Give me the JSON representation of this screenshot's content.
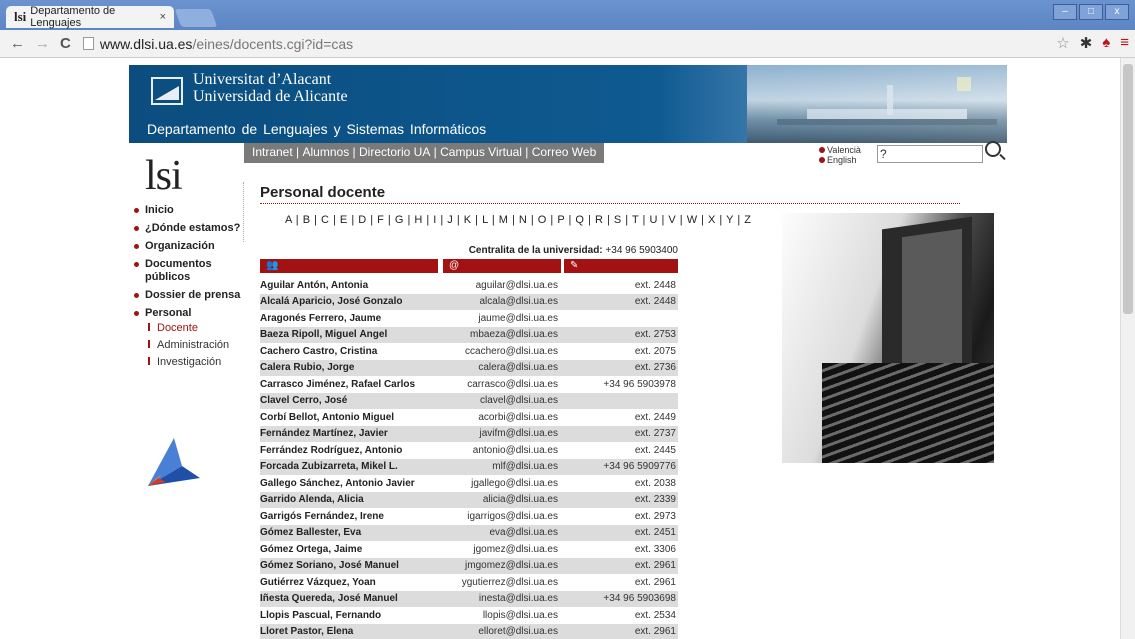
{
  "browser": {
    "tab_title": "Departamento de Lenguajes",
    "tab_favicon": "lsi",
    "url_host": "www.dlsi.ua.es",
    "url_path": "/eines/docents.cgi?id=cas",
    "icons": [
      "back-icon",
      "forward-icon",
      "reload-icon",
      "star-icon",
      "settings-icon",
      "extension-icon",
      "menu-icon"
    ]
  },
  "header": {
    "university_line1": "Universitat d’Alacant",
    "university_line2": "Universidad de Alicante",
    "department": "Departamento de Lenguajes y Sistemas Informáticos",
    "logo": "lsi"
  },
  "topnav": [
    "Intranet",
    "Alumnos",
    "Directorio UA",
    "Campus Virtual",
    "Correo Web"
  ],
  "lang": {
    "valencia": "Valencià",
    "english": "English"
  },
  "search": {
    "value": "?"
  },
  "leftnav": {
    "items": [
      "Inicio",
      "¿Dónde estamos?",
      "Organización",
      "Documentos públicos",
      "Dossier de prensa",
      "Personal"
    ],
    "sub": [
      "Docente",
      "Administración",
      "Investigación"
    ]
  },
  "main": {
    "title": "Personal docente",
    "letters": "A | B | C | E | D | F | G | H | I | J | K | L | M | N | O | P | Q | R | S | T | U | V | W | X | Y | Z",
    "centralita_label": "Centralita de la universidad:",
    "centralita_value": "+34 96 5903400",
    "col_email_icon": "@",
    "staff": [
      {
        "name": "Aguilar Antón, Antonia",
        "email": "aguilar@dlsi.ua.es",
        "ext": "ext. 2448"
      },
      {
        "name": "Alcalá Aparicio, José Gonzalo",
        "email": "alcala@dlsi.ua.es",
        "ext": "ext. 2448"
      },
      {
        "name": "Aragonés Ferrero, Jaume",
        "email": "jaume@dlsi.ua.es",
        "ext": ""
      },
      {
        "name": "Baeza Ripoll, Miguel Ángel",
        "email": "mbaeza@dlsi.ua.es",
        "ext": "ext. 2753"
      },
      {
        "name": "Cachero Castro, Cristina",
        "email": "ccachero@dlsi.ua.es",
        "ext": "ext. 2075"
      },
      {
        "name": "Calera Rubio, Jorge",
        "email": "calera@dlsi.ua.es",
        "ext": "ext. 2736"
      },
      {
        "name": "Carrasco Jiménez, Rafael Carlos",
        "email": "carrasco@dlsi.ua.es",
        "ext": "+34 96 5903978"
      },
      {
        "name": "Clavel Cerro, José",
        "email": "clavel@dlsi.ua.es",
        "ext": ""
      },
      {
        "name": "Corbí Bellot, Antonio Miguel",
        "email": "acorbi@dlsi.ua.es",
        "ext": "ext. 2449"
      },
      {
        "name": "Fernández Martínez, Javier",
        "email": "javifm@dlsi.ua.es",
        "ext": "ext. 2737"
      },
      {
        "name": "Ferrández Rodríguez, Antonio",
        "email": "antonio@dlsi.ua.es",
        "ext": "ext. 2445"
      },
      {
        "name": "Forcada Zubizarreta, Mikel L.",
        "email": "mlf@dlsi.ua.es",
        "ext": "+34 96 5909776"
      },
      {
        "name": "Gallego Sánchez, Antonio Javier",
        "email": "jgallego@dlsi.ua.es",
        "ext": "ext. 2038"
      },
      {
        "name": "Garrido Alenda, Alicia",
        "email": "alicia@dlsi.ua.es",
        "ext": "ext. 2339"
      },
      {
        "name": "Garrigós Fernández, Irene",
        "email": "igarrigos@dlsi.ua.es",
        "ext": "ext. 2973"
      },
      {
        "name": "Gómez Ballester, Eva",
        "email": "eva@dlsi.ua.es",
        "ext": "ext. 2451"
      },
      {
        "name": "Gómez Ortega, Jaime",
        "email": "jgomez@dlsi.ua.es",
        "ext": "ext. 3306"
      },
      {
        "name": "Gómez Soriano, José Manuel",
        "email": "jmgomez@dlsi.ua.es",
        "ext": "ext. 2961"
      },
      {
        "name": "Gutiérrez Vázquez, Yoan",
        "email": "ygutierrez@dlsi.ua.es",
        "ext": "ext. 2961"
      },
      {
        "name": "Iñesta Quereda, José Manuel",
        "email": "inesta@dlsi.ua.es",
        "ext": "+34 96 5903698"
      },
      {
        "name": "Llopis Pascual, Fernando",
        "email": "llopis@dlsi.ua.es",
        "ext": "ext. 2534"
      },
      {
        "name": "Lloret Pastor, Elena",
        "email": "elloret@dlsi.ua.es",
        "ext": "ext. 2961"
      }
    ]
  },
  "colors": {
    "accent": "#a31212",
    "banner": "#0e5a91",
    "nav_bg": "#7a7a7a"
  }
}
